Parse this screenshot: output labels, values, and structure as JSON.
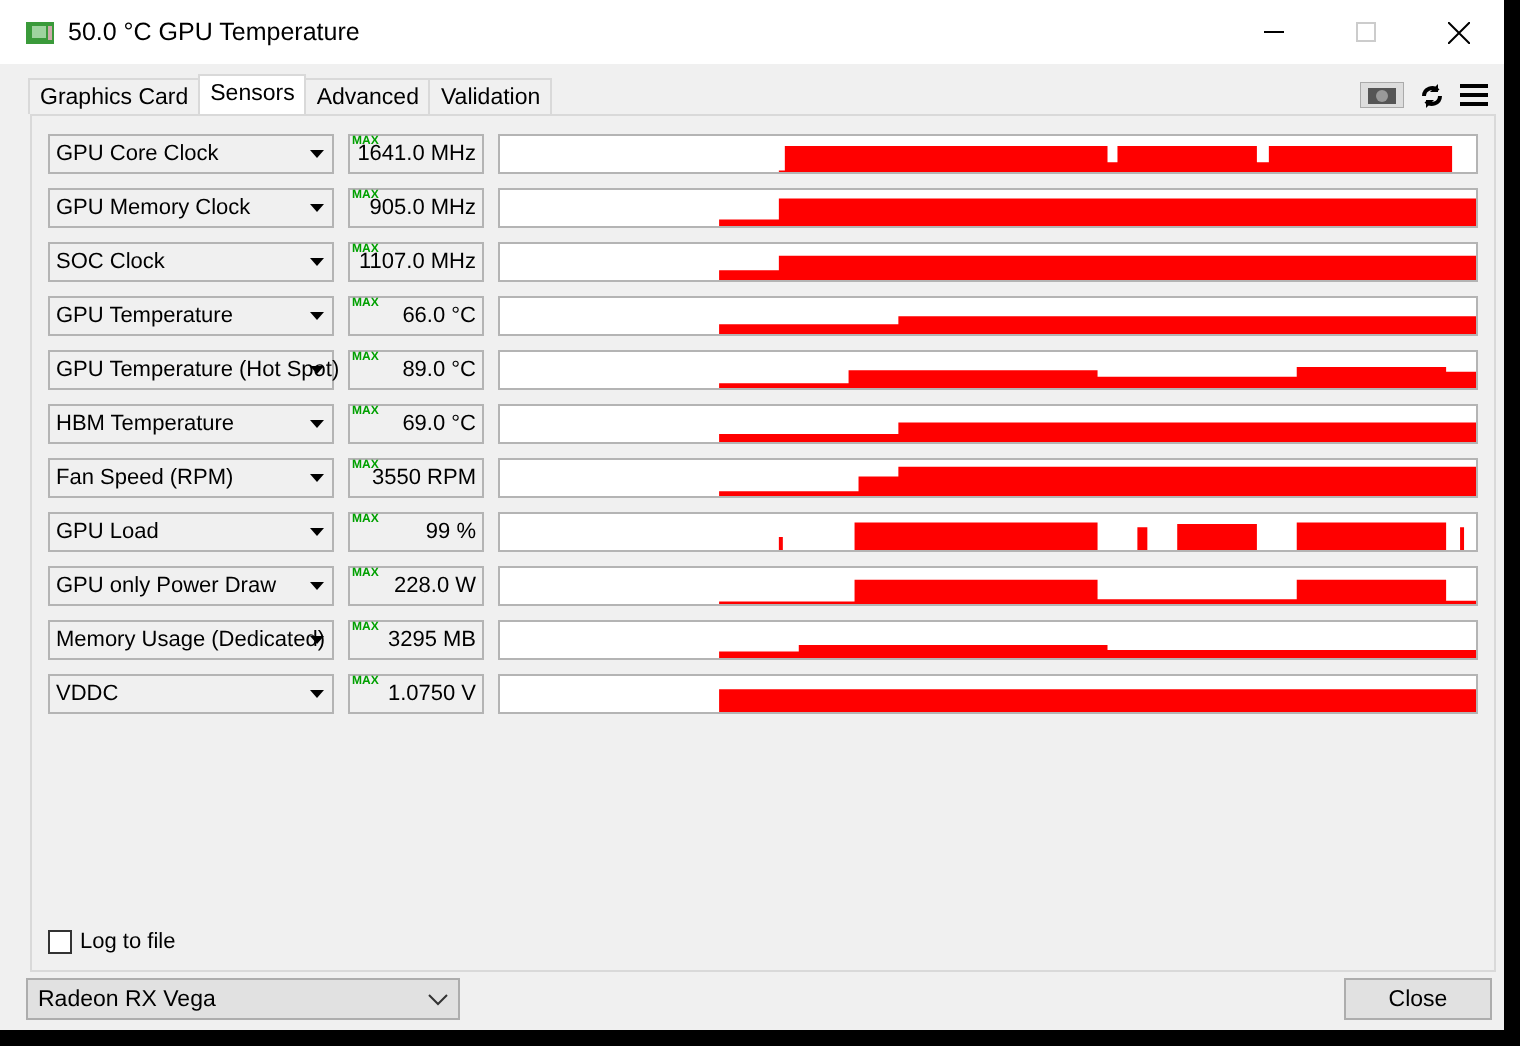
{
  "window": {
    "title": "50.0 °C GPU Temperature"
  },
  "tabs": [
    {
      "label": "Graphics Card",
      "selected": false
    },
    {
      "label": "Sensors",
      "selected": true
    },
    {
      "label": "Advanced",
      "selected": false
    },
    {
      "label": "Validation",
      "selected": false
    }
  ],
  "sensors": [
    {
      "label": "GPU Core Clock",
      "badge": "MAX",
      "value": "1641.0 MHz"
    },
    {
      "label": "GPU Memory Clock",
      "badge": "MAX",
      "value": "905.0 MHz"
    },
    {
      "label": "SOC Clock",
      "badge": "MAX",
      "value": "1107.0 MHz"
    },
    {
      "label": "GPU Temperature",
      "badge": "MAX",
      "value": "66.0 °C"
    },
    {
      "label": "GPU Temperature (Hot Spot)",
      "badge": "MAX",
      "value": "89.0 °C"
    },
    {
      "label": "HBM Temperature",
      "badge": "MAX",
      "value": "69.0 °C"
    },
    {
      "label": "Fan Speed (RPM)",
      "badge": "MAX",
      "value": "3550 RPM"
    },
    {
      "label": "GPU Load",
      "badge": "MAX",
      "value": "99 %"
    },
    {
      "label": "GPU only Power Draw",
      "badge": "MAX",
      "value": "228.0 W"
    },
    {
      "label": "Memory Usage (Dedicated)",
      "badge": "MAX",
      "value": "3295 MB"
    },
    {
      "label": "VDDC",
      "badge": "MAX",
      "value": "1.0750 V"
    }
  ],
  "log_to_file": {
    "label": "Log to file",
    "checked": false
  },
  "device_select": {
    "value": "Radeon RX Vega"
  },
  "close_button": {
    "label": "Close"
  }
}
